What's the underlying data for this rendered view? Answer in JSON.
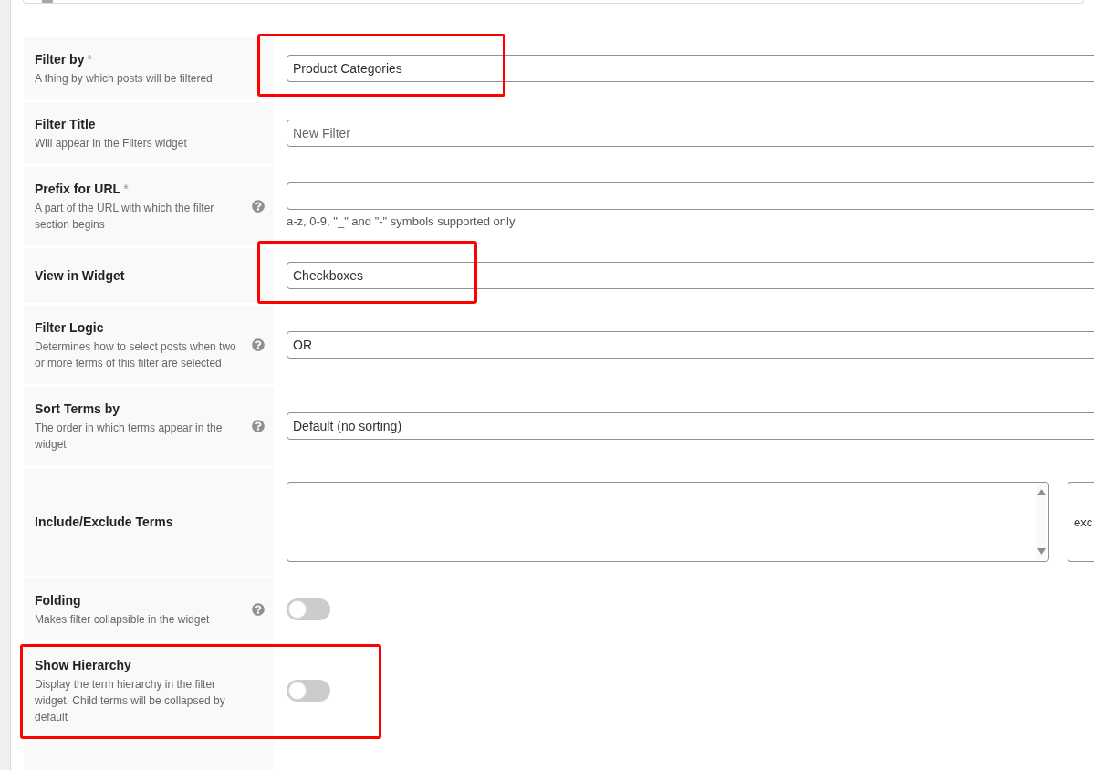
{
  "rows": [
    {
      "kind": "select",
      "label": "Filter by",
      "required_mark": "*",
      "description": "A thing by which posts will be filtered",
      "help": false,
      "value": "Product Categories",
      "highlighted": true
    },
    {
      "kind": "text",
      "label": "Filter Title",
      "description": "Will appear in the Filters widget",
      "help": false,
      "placeholder": "New Filter",
      "highlighted": false
    },
    {
      "kind": "text",
      "label": "Prefix for URL",
      "required_mark": "*",
      "description": "A part of the URL with which the filter section begins",
      "help": true,
      "hint": "a-z, 0-9, \"_\" and \"-\" symbols supported only",
      "highlighted": false
    },
    {
      "kind": "select",
      "label": "View in Widget",
      "help": false,
      "value": "Checkboxes",
      "highlighted": true
    },
    {
      "kind": "select",
      "label": "Filter Logic",
      "description": "Determines how to select posts when two or more terms of this filter are selected",
      "help": true,
      "value": "OR",
      "highlighted": false
    },
    {
      "kind": "select",
      "label": "Sort Terms by",
      "description": "The order in which terms appear in the widget",
      "help": true,
      "value": "Default (no sorting)",
      "highlighted": false
    },
    {
      "kind": "terms",
      "label": "Include/Exclude Terms",
      "help": false,
      "mode_value": "exc",
      "highlighted": false
    },
    {
      "kind": "toggle",
      "label": "Folding",
      "description": "Makes filter collapsible in the widget",
      "help": true,
      "on": false,
      "highlighted": false
    },
    {
      "kind": "toggle",
      "label": "Show Hierarchy",
      "description": "Display the term hierarchy in the filter widget. Child terms will be collapsed by default",
      "help": false,
      "on": false,
      "highlighted": true
    }
  ]
}
